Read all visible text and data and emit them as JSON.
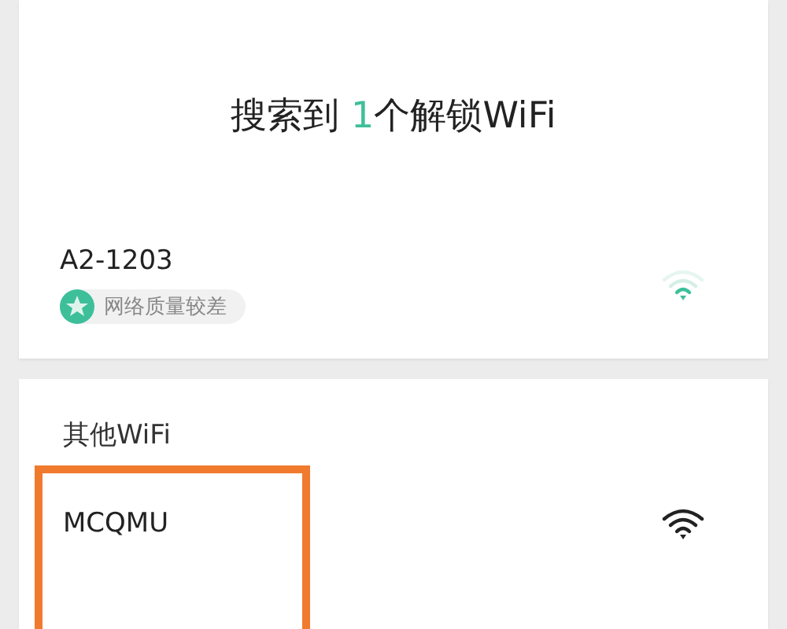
{
  "unlock_section": {
    "title": {
      "prefix": "搜索到 ",
      "count": "1",
      "suffix": "个解锁WiFi"
    },
    "networks": [
      {
        "name": "A2-1203",
        "badge": "网络质量较差"
      }
    ]
  },
  "other_section": {
    "heading": "其他WiFi",
    "networks": [
      {
        "name": "MCQMU",
        "highlighted": true
      }
    ]
  }
}
